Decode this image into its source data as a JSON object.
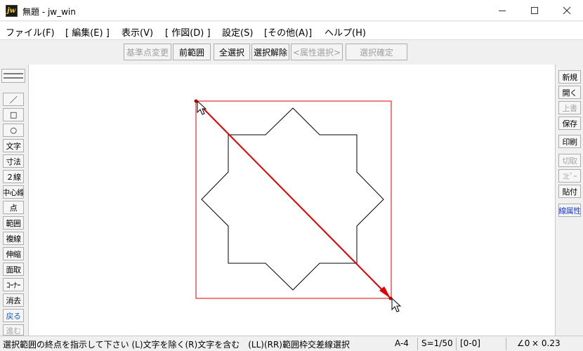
{
  "window": {
    "app_icon_text": "jw",
    "title": "無題 - jw_win"
  },
  "menu": [
    "ファイル(F)",
    "[ 編集(E) ]",
    "表示(V)",
    "[ 作図(D) ]",
    "設定(S)",
    "[その他(A)]",
    "ヘルプ(H)"
  ],
  "toolbar": {
    "base_point": "基準点変更",
    "prev_range": "前範囲",
    "select_all": "全選択",
    "deselect": "選択解除",
    "attr_select": "<属性選択>",
    "confirm": "選択確定"
  },
  "left_tools": [
    "／",
    "□",
    "○",
    "文字",
    "寸法",
    "２線",
    "中心線",
    "点",
    "範囲",
    "複線",
    "伸縮",
    "面取",
    "ｺｰﾅｰ",
    "消去",
    "戻る",
    "進む"
  ],
  "right_tools": [
    "新規",
    "開く",
    "上書",
    "保存",
    "印刷",
    "切取",
    "ｺﾋﾟｰ",
    "貼付",
    "線属性"
  ],
  "status": {
    "message": "選択範囲の終点を指示して下さい (L)文字を除く(R)文字を含む　(LL)(RR)範囲枠交差線選択",
    "paper": "A-4",
    "scale": "S=1/50",
    "layer": "[0-0]",
    "angle": "∠0",
    "zoom": "× 0.23"
  },
  "colors": {
    "selection": "#e00000",
    "drawing": "#000000",
    "canvas": "#ffffff"
  }
}
